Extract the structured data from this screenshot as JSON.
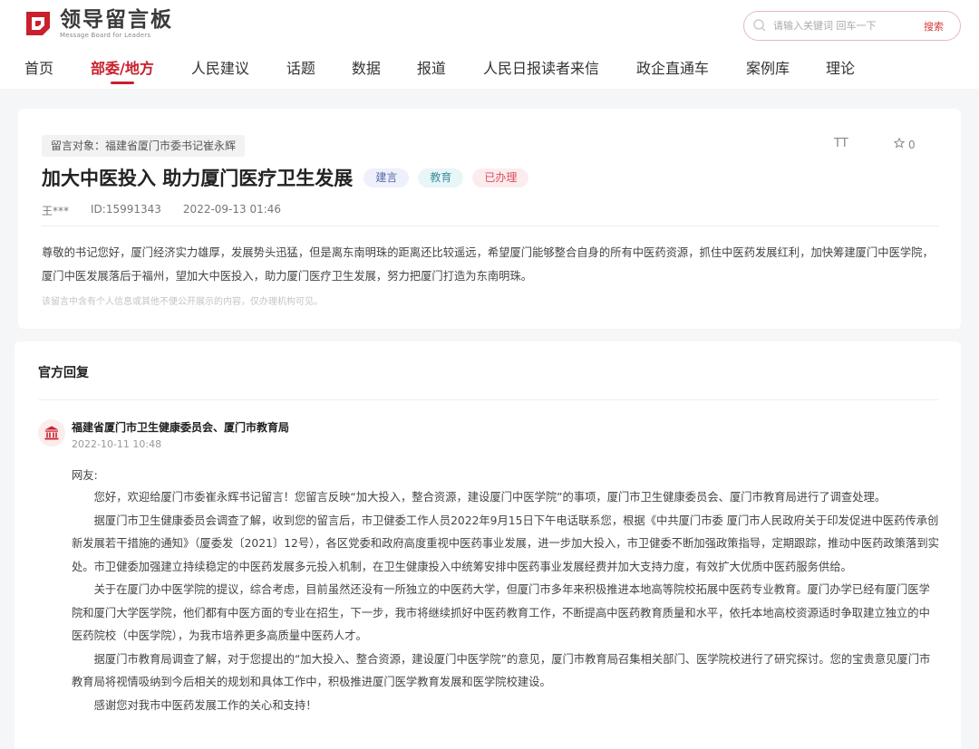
{
  "brand": {
    "name_cn": "领导留言板",
    "name_en": "Message Board for Leaders",
    "color": "#c8202d"
  },
  "search": {
    "placeholder": "请输入关键词 回车一下",
    "button_label": "搜索",
    "icon": "search-icon"
  },
  "nav": {
    "items": [
      {
        "label": "首页"
      },
      {
        "label": "部委/地方",
        "active": true
      },
      {
        "label": "人民建议"
      },
      {
        "label": "话题"
      },
      {
        "label": "数据"
      },
      {
        "label": "报道"
      },
      {
        "label": "人民日报读者来信"
      },
      {
        "label": "政企直通车"
      },
      {
        "label": "案例库"
      },
      {
        "label": "理论"
      }
    ]
  },
  "message": {
    "target": "留言对象：福建省厦门市委书记崔永辉",
    "title": "加大中医投入 助力厦门医疗卫生发展",
    "tags": [
      "建言",
      "教育",
      "已办理"
    ],
    "author": "王***",
    "id": "ID:15991343",
    "datetime": "2022-09-13 01:46",
    "font_toggle": "TT",
    "favorites": "0",
    "body": "尊敬的书记您好，厦门经济实力雄厚，发展势头迅猛，但是离东南明珠的距离还比较遥远，希望厦门能够整合自身的所有中医药资源，抓住中医药发展红利，加快筹建厦门中医学院，厦门中医发展落后于福州，望加大中医投入，助力厦门医疗卫生发展，努力把厦门打造为东南明珠。",
    "privacy_note": "该留言中含有个人信息或其他不便公开展示的内容，仅办理机构可见。"
  },
  "reply": {
    "heading": "官方回复",
    "org": "福建省厦门市卫生健康委员会、厦门市教育局",
    "datetime": "2022-10-11 10:48",
    "greeting": "网友:",
    "paragraphs": [
      "您好，欢迎给厦门市委崔永辉书记留言！您留言反映“加大投入，整合资源，建设厦门中医学院”的事项，厦门市卫生健康委员会、厦门市教育局进行了调查处理。",
      "据厦门市卫生健康委员会调查了解，收到您的留言后，市卫健委工作人员2022年9月15日下午电话联系您，根据《中共厦门市委 厦门市人民政府关于印发促进中医药传承创新发展若干措施的通知》（厦委发〔2021〕12号），各区党委和政府高度重视中医药事业发展，进一步加大投入，市卫健委不断加强政策指导，定期跟踪，推动中医药政策落到实处。市卫健委加强建立持续稳定的中医药发展多元投入机制，在卫生健康投入中统筹安排中医药事业发展经费并加大支持力度，有效扩大优质中医药服务供给。",
      "关于在厦门办中医学院的提议，综合考虑，目前虽然还没有一所独立的中医药大学，但厦门市多年来积极推进本地高等院校拓展中医药专业教育。厦门办学已经有厦门医学院和厦门大学医学院，他们都有中医方面的专业在招生，下一步，我市将继续抓好中医药教育工作，不断提高中医药教育质量和水平，依托本地高校资源适时争取建立独立的中医药院校（中医学院），为我市培养更多高质量中医药人才。",
      "据厦门市教育局调查了解，对于您提出的“加大投入、整合资源，建设厦门中医学院”的意见，厦门市教育局召集相关部门、医学院校进行了研究探讨。您的宝贵意见厦门市教育局将视情吸纳到今后相关的规划和具体工作中，积极推进厦门医学教育发展和医学院校建设。",
      "感谢您对我市中医药发展工作的关心和支持！"
    ]
  }
}
